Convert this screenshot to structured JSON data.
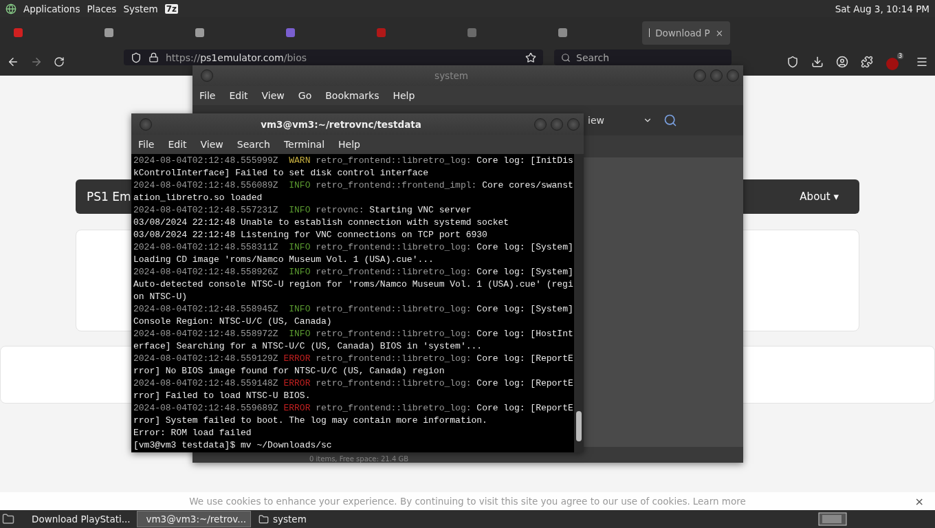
{
  "top_panel": {
    "menus": [
      "Applications",
      "Places",
      "System"
    ],
    "badge": "7z",
    "clock": "Sat Aug  3, 10:14 PM"
  },
  "browser": {
    "tabs": [
      {
        "selected": false,
        "color": "#d02020"
      },
      {
        "selected": false,
        "color": "#9a9a9a"
      },
      {
        "selected": false,
        "color": "#9a9a9a"
      },
      {
        "selected": false,
        "color": "#7a5fd0"
      },
      {
        "selected": false,
        "color": "#b01818"
      },
      {
        "selected": false,
        "color": "#6a6a6a"
      },
      {
        "selected": false,
        "color": "#8a8a8a"
      },
      {
        "selected": true,
        "color": "#cfcfcf",
        "label": "Download P",
        "close": "×"
      }
    ],
    "url": {
      "scheme": "https://",
      "host": "ps1emulator.com",
      "path": "/bios"
    },
    "search": {
      "placeholder": "Search"
    },
    "extension_badge": "3",
    "page": {
      "brand": "PS1 Em",
      "nav_item": "About ▾",
      "cookie": {
        "text": "We use cookies to enhance your experience. By continuing to visit this site you agree to our use of cookies.",
        "link": "Learn more",
        "close": "×"
      }
    }
  },
  "file_manager": {
    "title": "system",
    "menu": [
      "File",
      "Edit",
      "View",
      "Go",
      "Bookmarks",
      "Help"
    ],
    "view_label": "iew",
    "status": "0 items, Free space: 21.4 GB"
  },
  "terminal": {
    "title": "vm3@vm3:~/retrovnc/testdata",
    "menu": [
      "File",
      "Edit",
      "View",
      "Search",
      "Terminal",
      "Help"
    ],
    "lines": [
      {
        "kind": "log",
        "time": "2024-08-04T02:12:48.555999Z",
        "level": "WARN",
        "color": "#c8b040",
        "module": "retro_frontend::libretro_log:",
        "message": "Core log: [InitDiskControlInterface] Failed to set disk control interface"
      },
      {
        "kind": "log",
        "time": "2024-08-04T02:12:48.556089Z",
        "level": "INFO",
        "color": "#5a9a30",
        "module": "retro_frontend::frontend_impl:",
        "message": "Core cores/swanstation_libretro.so loaded"
      },
      {
        "kind": "log",
        "time": "2024-08-04T02:12:48.557231Z",
        "level": "INFO",
        "color": "#5a9a30",
        "module": "retrovnc:",
        "message": "Starting VNC server"
      },
      {
        "kind": "plain",
        "text": "03/08/2024 22:12:48 Unable to establish connection with systemd socket"
      },
      {
        "kind": "plain",
        "text": "03/08/2024 22:12:48 Listening for VNC connections on TCP port 6930"
      },
      {
        "kind": "log",
        "time": "2024-08-04T02:12:48.558311Z",
        "level": "INFO",
        "color": "#5a9a30",
        "module": "retro_frontend::libretro_log:",
        "message": "Core log: [System] Loading CD image 'roms/Namco Museum Vol. 1 (USA).cue'..."
      },
      {
        "kind": "log",
        "time": "2024-08-04T02:12:48.558926Z",
        "level": "INFO",
        "color": "#5a9a30",
        "module": "retro_frontend::libretro_log:",
        "message": "Core log: [System] Auto-detected console NTSC-U region for 'roms/Namco Museum Vol. 1 (USA).cue' (region NTSC-U)"
      },
      {
        "kind": "log",
        "time": "2024-08-04T02:12:48.558945Z",
        "level": "INFO",
        "color": "#5a9a30",
        "module": "retro_frontend::libretro_log:",
        "message": "Core log: [System] Console Region: NTSC-U/C (US, Canada)"
      },
      {
        "kind": "log",
        "time": "2024-08-04T02:12:48.558972Z",
        "level": "INFO",
        "color": "#5a9a30",
        "module": "retro_frontend::libretro_log:",
        "message": "Core log: [HostInterface] Searching for a NTSC-U/C (US, Canada) BIOS in 'system'..."
      },
      {
        "kind": "log",
        "time": "2024-08-04T02:12:48.559129Z",
        "level": "ERROR",
        "color": "#c02020",
        "module": "retro_frontend::libretro_log:",
        "message": "Core log: [ReportError] No BIOS image found for NTSC-U/C (US, Canada) region"
      },
      {
        "kind": "log",
        "time": "2024-08-04T02:12:48.559148Z",
        "level": "ERROR",
        "color": "#c02020",
        "module": "retro_frontend::libretro_log:",
        "message": "Core log: [ReportError] Failed to load NTSC-U BIOS."
      },
      {
        "kind": "log",
        "time": "2024-08-04T02:12:48.559689Z",
        "level": "ERROR",
        "color": "#c02020",
        "module": "retro_frontend::libretro_log:",
        "message": "Core log: [ReportError] System failed to boot. The log may contain more information."
      },
      {
        "kind": "plain",
        "text": "Error: ROM load failed"
      },
      {
        "kind": "prompt",
        "text": "[vm3@vm3 testdata]$ mv ~/Downloads/sc"
      }
    ]
  },
  "taskbar": {
    "items": [
      {
        "kind": "browser",
        "label": "Download PlayStati...",
        "selected": false
      },
      {
        "kind": "terminal",
        "label": "vm3@vm3:~/retrov...",
        "selected": true
      },
      {
        "kind": "folder",
        "label": "system",
        "selected": false
      }
    ]
  }
}
